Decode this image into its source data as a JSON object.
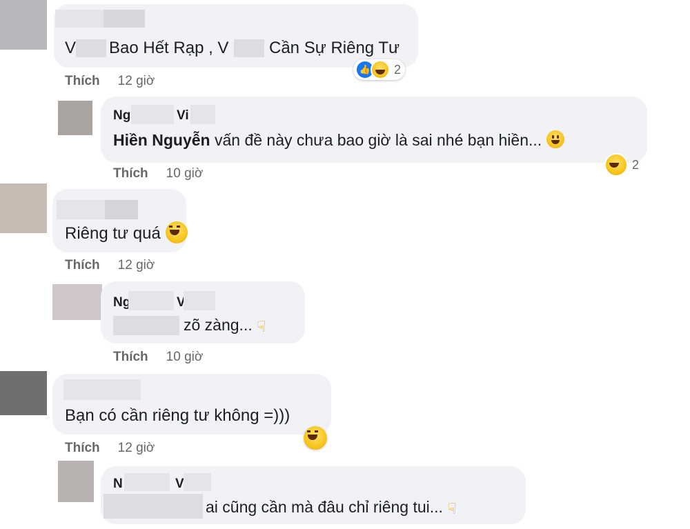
{
  "like_label": "Thích",
  "comments": [
    {
      "text_parts": [
        "V",
        "Bao Hết Rạp , V",
        "Cần Sự Riêng Tư"
      ],
      "time": "12 giờ",
      "reaction_count": "2",
      "reply": {
        "name_parts": [
          "Ng",
          "Vi"
        ],
        "mention": "Hiền Nguyễn",
        "text": "vấn đề này chưa bao giờ là sai nhé bạn hiền...",
        "time": "10 giờ",
        "reaction_count": "2"
      }
    },
    {
      "text": "Riêng tư quá",
      "time": "12 giờ",
      "reply": {
        "name_parts": [
          "Ng",
          "V"
        ],
        "text": "zõ zàng...",
        "time": "10 giờ"
      }
    },
    {
      "text": "Bạn có cần riêng tư không =)))",
      "time": "12 giờ",
      "reply": {
        "name_parts": [
          "N",
          "V"
        ],
        "text": "ai cũng cần mà đâu chỉ riêng tui..."
      }
    }
  ],
  "icons": {
    "like_reaction": "thumbs-up-icon",
    "haha_reaction": "laughing-face-icon",
    "smile_emoji": "smiling-face-icon",
    "hand_emoji": "pointing-hand-icon"
  },
  "colors": {
    "bubble": "#f0f2f5",
    "meta": "#65676b",
    "like_blue": "#1877f2"
  }
}
